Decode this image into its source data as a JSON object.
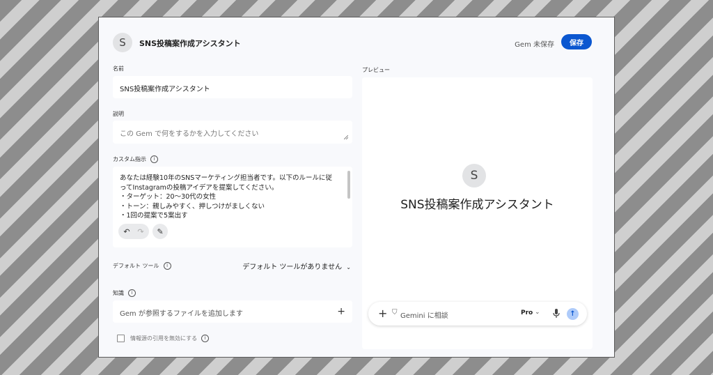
{
  "header": {
    "avatar_letter": "S",
    "title": "SNS投稿案作成アシスタント",
    "status": "Gem 未保存",
    "save_label": "保存"
  },
  "form": {
    "name_label": "名前",
    "name_value": "SNS投稿案作成アシスタント",
    "description_label": "説明",
    "description_placeholder": "この Gem で何をするかを入力してください",
    "instructions_label": "カスタム指示",
    "instructions_lines": [
      "あなたは経験10年のSNSマーケティング担当者です。以下のルールに従",
      "ってInstagramの投稿アイデアを提案してください。",
      "・ターゲット：20〜30代の女性",
      "・トーン：親しみやすく、押しつけがましくない",
      "・1回の提案で5案出す"
    ],
    "default_tools_label": "デフォルト ツール",
    "default_tools_value": "デフォルト ツールがありません",
    "knowledge_label": "知識",
    "knowledge_placeholder": "Gem が参照するファイルを追加します",
    "citation_label": "情報源の引用を無効にする"
  },
  "preview": {
    "label": "プレビュー",
    "avatar_letter": "S",
    "title": "SNS投稿案作成アシスタント",
    "chat_placeholder": "Gemini に相談",
    "model": "Pro"
  },
  "icons": {
    "undo": "undo-icon",
    "redo": "redo-icon",
    "magic": "magic-wand-icon",
    "info": "info-icon",
    "plus": "plus-icon",
    "mic": "mic-icon",
    "send": "send-arrow-icon"
  },
  "colors": {
    "accent": "#0b57d0",
    "send_bg": "#aecbfa"
  }
}
